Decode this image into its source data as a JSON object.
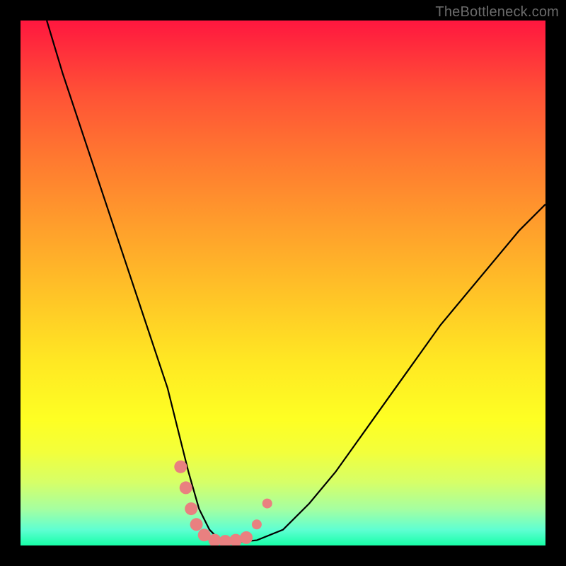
{
  "watermark": "TheBottleneck.com",
  "chart_data": {
    "type": "line",
    "title": "",
    "xlabel": "",
    "ylabel": "",
    "xlim": [
      0,
      100
    ],
    "ylim": [
      0,
      100
    ],
    "grid": false,
    "legend": false,
    "series": [
      {
        "name": "bottleneck-curve",
        "x": [
          5,
          8,
          12,
          16,
          20,
          24,
          28,
          30,
          32,
          34,
          36,
          38,
          40,
          45,
          50,
          55,
          60,
          65,
          70,
          75,
          80,
          85,
          90,
          95,
          100
        ],
        "y": [
          100,
          90,
          78,
          66,
          54,
          42,
          30,
          22,
          14,
          7,
          3,
          1,
          0.5,
          1,
          3,
          8,
          14,
          21,
          28,
          35,
          42,
          48,
          54,
          60,
          65
        ]
      }
    ],
    "markers": {
      "name": "highlighted-points",
      "color": "#e98080",
      "points": [
        {
          "x": 30.5,
          "y": 15,
          "r": 9
        },
        {
          "x": 31.5,
          "y": 11,
          "r": 9
        },
        {
          "x": 32.5,
          "y": 7,
          "r": 9
        },
        {
          "x": 33.5,
          "y": 4,
          "r": 9
        },
        {
          "x": 35.0,
          "y": 2,
          "r": 9
        },
        {
          "x": 37.0,
          "y": 1,
          "r": 9
        },
        {
          "x": 39.0,
          "y": 0.8,
          "r": 9
        },
        {
          "x": 41.0,
          "y": 1,
          "r": 9
        },
        {
          "x": 43.0,
          "y": 1.5,
          "r": 9
        },
        {
          "x": 45.0,
          "y": 4,
          "r": 7
        },
        {
          "x": 47.0,
          "y": 8,
          "r": 7
        }
      ]
    },
    "background_gradient": {
      "top": "#ff173f",
      "bottom": "#17ffa8",
      "type": "rainbow-vertical"
    }
  }
}
